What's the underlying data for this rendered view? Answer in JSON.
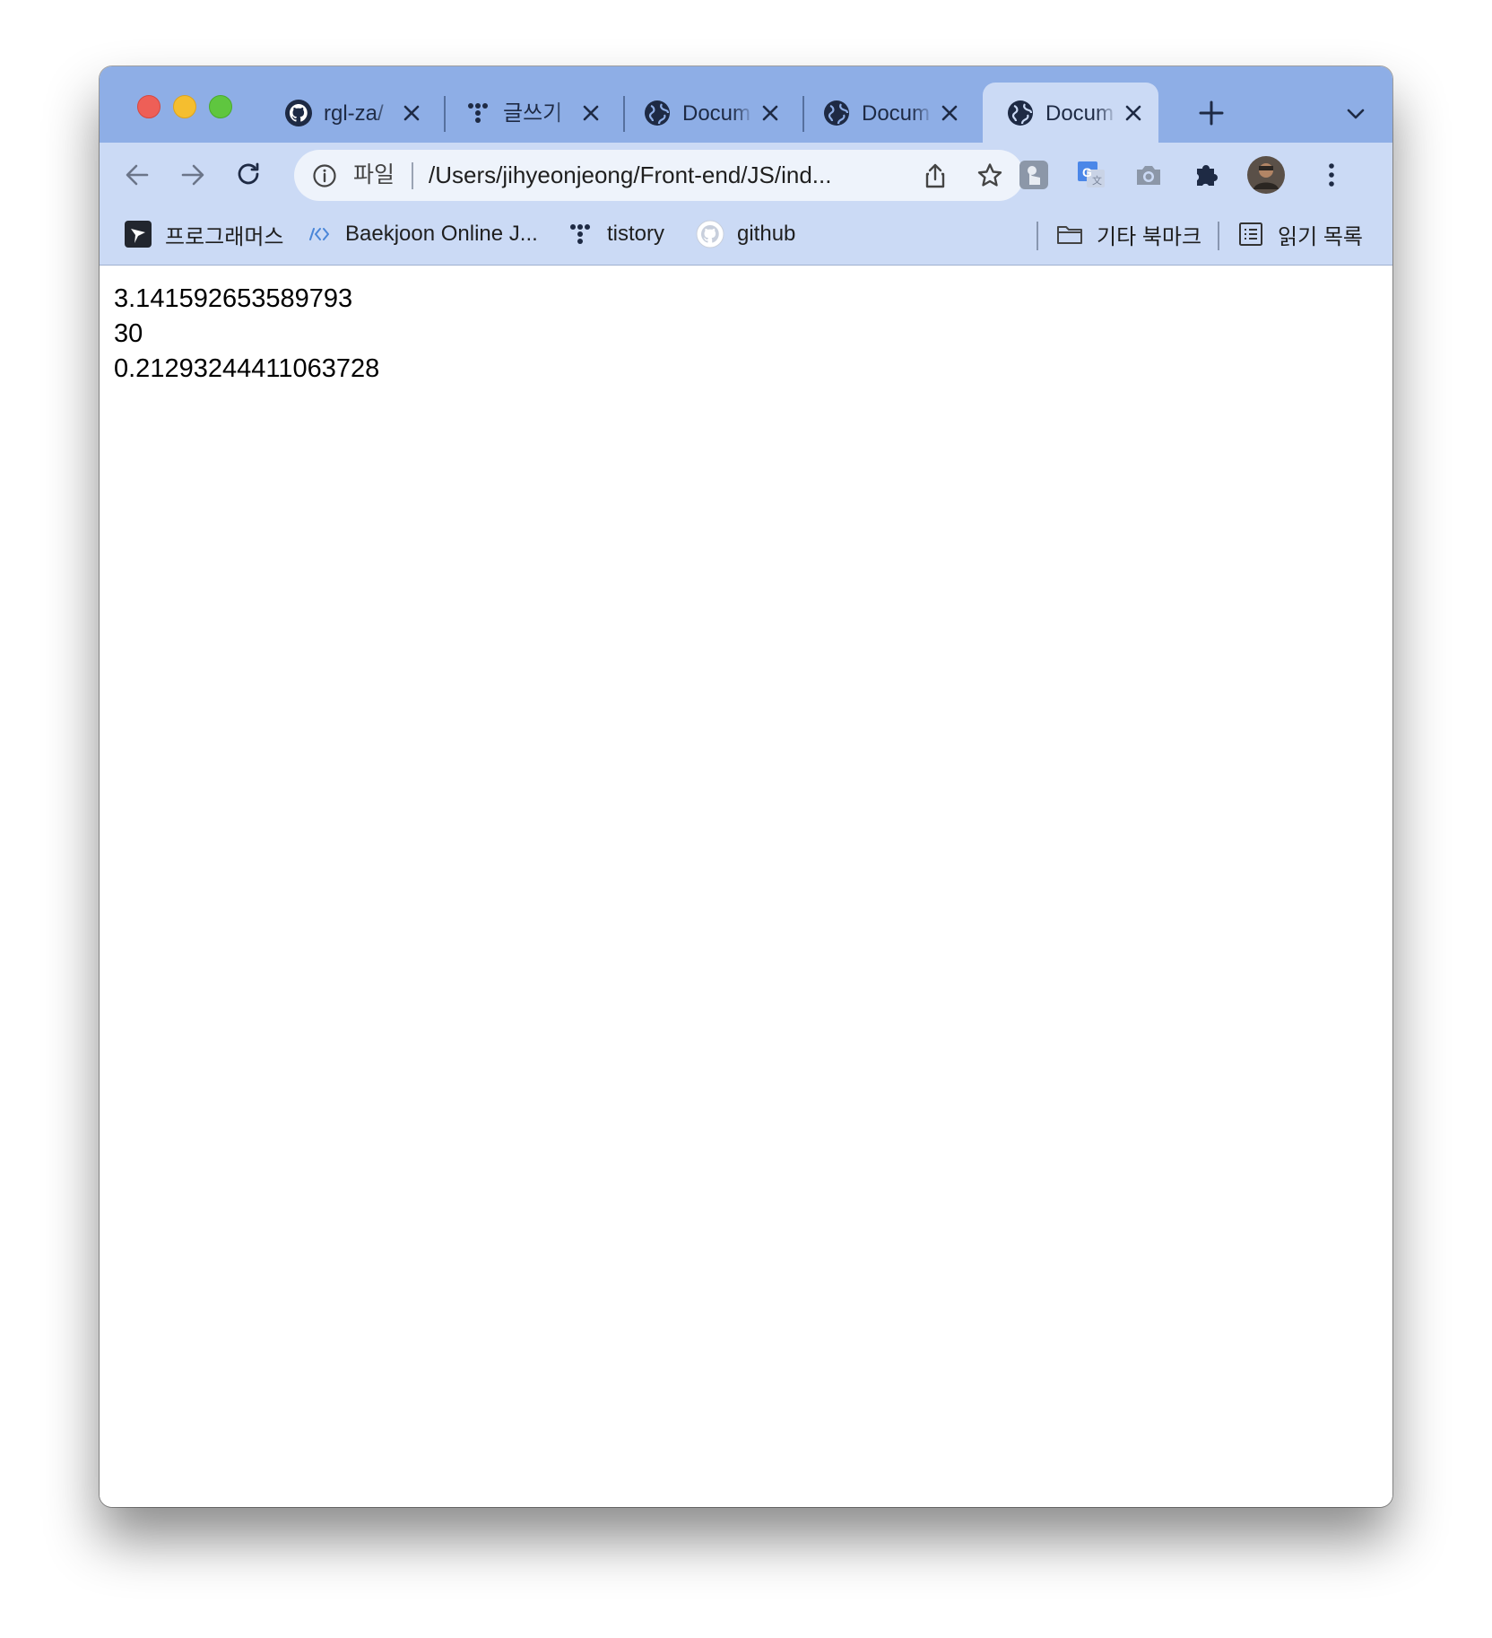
{
  "tabs": [
    {
      "title": "rgl-za/",
      "icon": "github-icon"
    },
    {
      "title": "글쓰기",
      "icon": "tistory-icon"
    },
    {
      "title": "Docum",
      "icon": "globe-icon"
    },
    {
      "title": "Docum",
      "icon": "globe-icon"
    },
    {
      "title": "Docum",
      "icon": "globe-icon",
      "active": true
    }
  ],
  "omnibox": {
    "scheme_label": "파일",
    "url": "/Users/jihyeonjeong/Front-end/JS/ind..."
  },
  "bookmarks": {
    "items": [
      {
        "label": "프로그래머스",
        "icon": "programmers-icon"
      },
      {
        "label": "Baekjoon Online J...",
        "icon": "code-brackets-icon"
      },
      {
        "label": "tistory",
        "icon": "tistory-icon"
      },
      {
        "label": "github",
        "icon": "github-icon"
      }
    ],
    "other_label": "기타 북마크",
    "reading_list_label": "읽기 목록"
  },
  "output": {
    "lines": [
      "3.141592653589793",
      "30",
      "0.21293244411063728"
    ]
  },
  "colors": {
    "tab_strip": "#8eaee6",
    "toolbar": "#cbdaf5",
    "omnibox": "#eef3fb"
  }
}
